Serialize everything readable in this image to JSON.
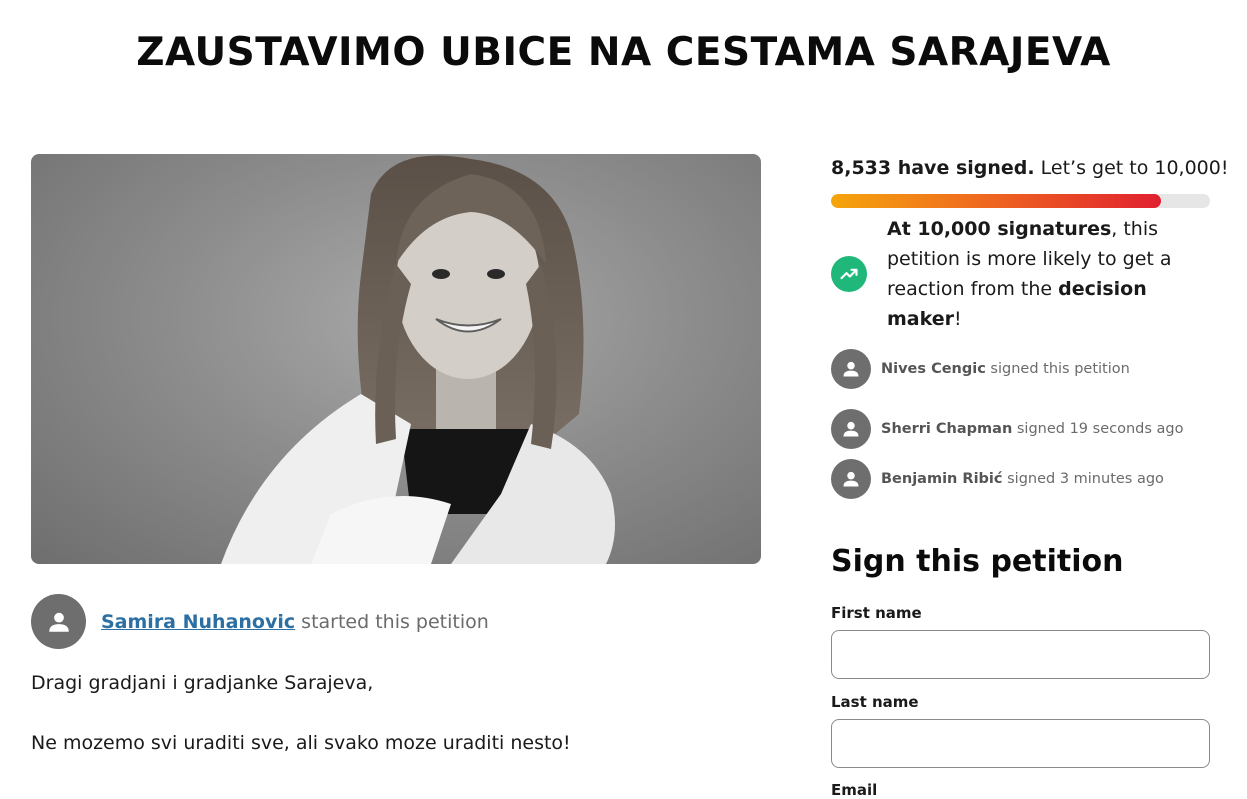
{
  "petition": {
    "title": "ZAUSTAVIMO UBICE NA CESTAMA SARAJEVA",
    "starter_name": "Samira Nuhanovic",
    "starter_suffix": " started this petition",
    "body": [
      "Dragi gradjani i gradjanke Sarajeva,",
      "Ne mozemo svi uraditi sve, ali svako moze uraditi nesto!"
    ]
  },
  "progress": {
    "signed_count_text": "8,533 have signed.",
    "goal_text": " Let’s get to 10,000!",
    "signed": 8533,
    "goal": 10000,
    "fill_fraction": 0.87,
    "colors": [
      "#f5a50c",
      "#ef6a1f",
      "#e0202f"
    ]
  },
  "milestone": {
    "lead_bold": "At 10,000 signatures",
    "middle": ", this petition is more likely to get a reaction from the ",
    "target_bold": "decision maker",
    "end": "!",
    "icon": "trending-up-icon",
    "icon_color": "#1fb87a"
  },
  "recent_signers": [
    {
      "name": "Nives Cengic",
      "text": " signed this petition"
    },
    {
      "name": "Sherri Chapman",
      "text": " signed 19 seconds ago"
    },
    {
      "name": "Benjamin Ribić",
      "text": " signed 3 minutes ago"
    }
  ],
  "sign_form": {
    "heading": "Sign this petition",
    "first_name_label": "First name",
    "first_name_value": "",
    "last_name_label": "Last name",
    "last_name_value": "",
    "email_label": "Email"
  }
}
